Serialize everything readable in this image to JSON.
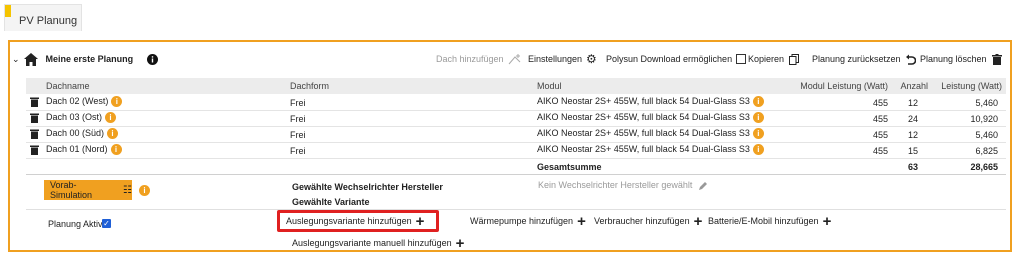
{
  "tab": {
    "label": "PV Planung"
  },
  "header": {
    "title": "Meine erste Planung",
    "dach_add": "Dach hinzufügen",
    "settings": "Einstellungen",
    "polysun": "Polysun Download ermöglichen",
    "copy": "Kopieren",
    "reset": "Planung zurücksetzen",
    "delete": "Planung löschen"
  },
  "table": {
    "columns": {
      "dachname": "Dachname",
      "dachform": "Dachform",
      "modul": "Modul",
      "leistung_modul": "Modul Leistung (Watt)",
      "anzahl": "Anzahl",
      "leistung": "Leistung (Watt)"
    },
    "rows": [
      {
        "dachname": "Dach 02 (West)",
        "dachform": "Frei",
        "modul": "AIKO Neostar 2S+ 455W, full black 54 Dual-Glass S3",
        "leistung_modul": "455",
        "anzahl": "12",
        "leistung": "5,460"
      },
      {
        "dachname": "Dach 03 (Ost)",
        "dachform": "Frei",
        "modul": "AIKO Neostar 2S+ 455W, full black 54 Dual-Glass S3",
        "leistung_modul": "455",
        "anzahl": "24",
        "leistung": "10,920"
      },
      {
        "dachname": "Dach 00 (Süd)",
        "dachform": "Frei",
        "modul": "AIKO Neostar 2S+ 455W, full black 54 Dual-Glass S3",
        "leistung_modul": "455",
        "anzahl": "12",
        "leistung": "5,460"
      },
      {
        "dachname": "Dach 01 (Nord)",
        "dachform": "Frei",
        "modul": "AIKO Neostar 2S+ 455W, full black 54 Dual-Glass S3",
        "leistung_modul": "455",
        "anzahl": "15",
        "leistung": "6,825"
      }
    ],
    "total": {
      "label": "Gesamtsumme",
      "anzahl": "63",
      "leistung": "28,665"
    }
  },
  "simulation": {
    "button": "Vorab-Simulation",
    "hersteller_label": "Gewählte Wechselrichter Hersteller",
    "variante_label": "Gewählte Variante",
    "hersteller_value": "Kein Wechselrichter Hersteller gewählt"
  },
  "footer": {
    "planung_aktiv": "Planung Aktiv",
    "auslegung_add": "Auslegungsvariante hinzufügen",
    "auslegung_manuell": "Auslegungsvariante manuell hinzufügen",
    "waermepumpe": "Wärmepumpe hinzufügen",
    "verbraucher": "Verbraucher hinzufügen",
    "batterie": "Batterie/E-Mobil hinzufügen"
  },
  "colors": {
    "accent": "#f0a020",
    "highlight": "#e02020",
    "tab_accent": "#f5c400"
  }
}
